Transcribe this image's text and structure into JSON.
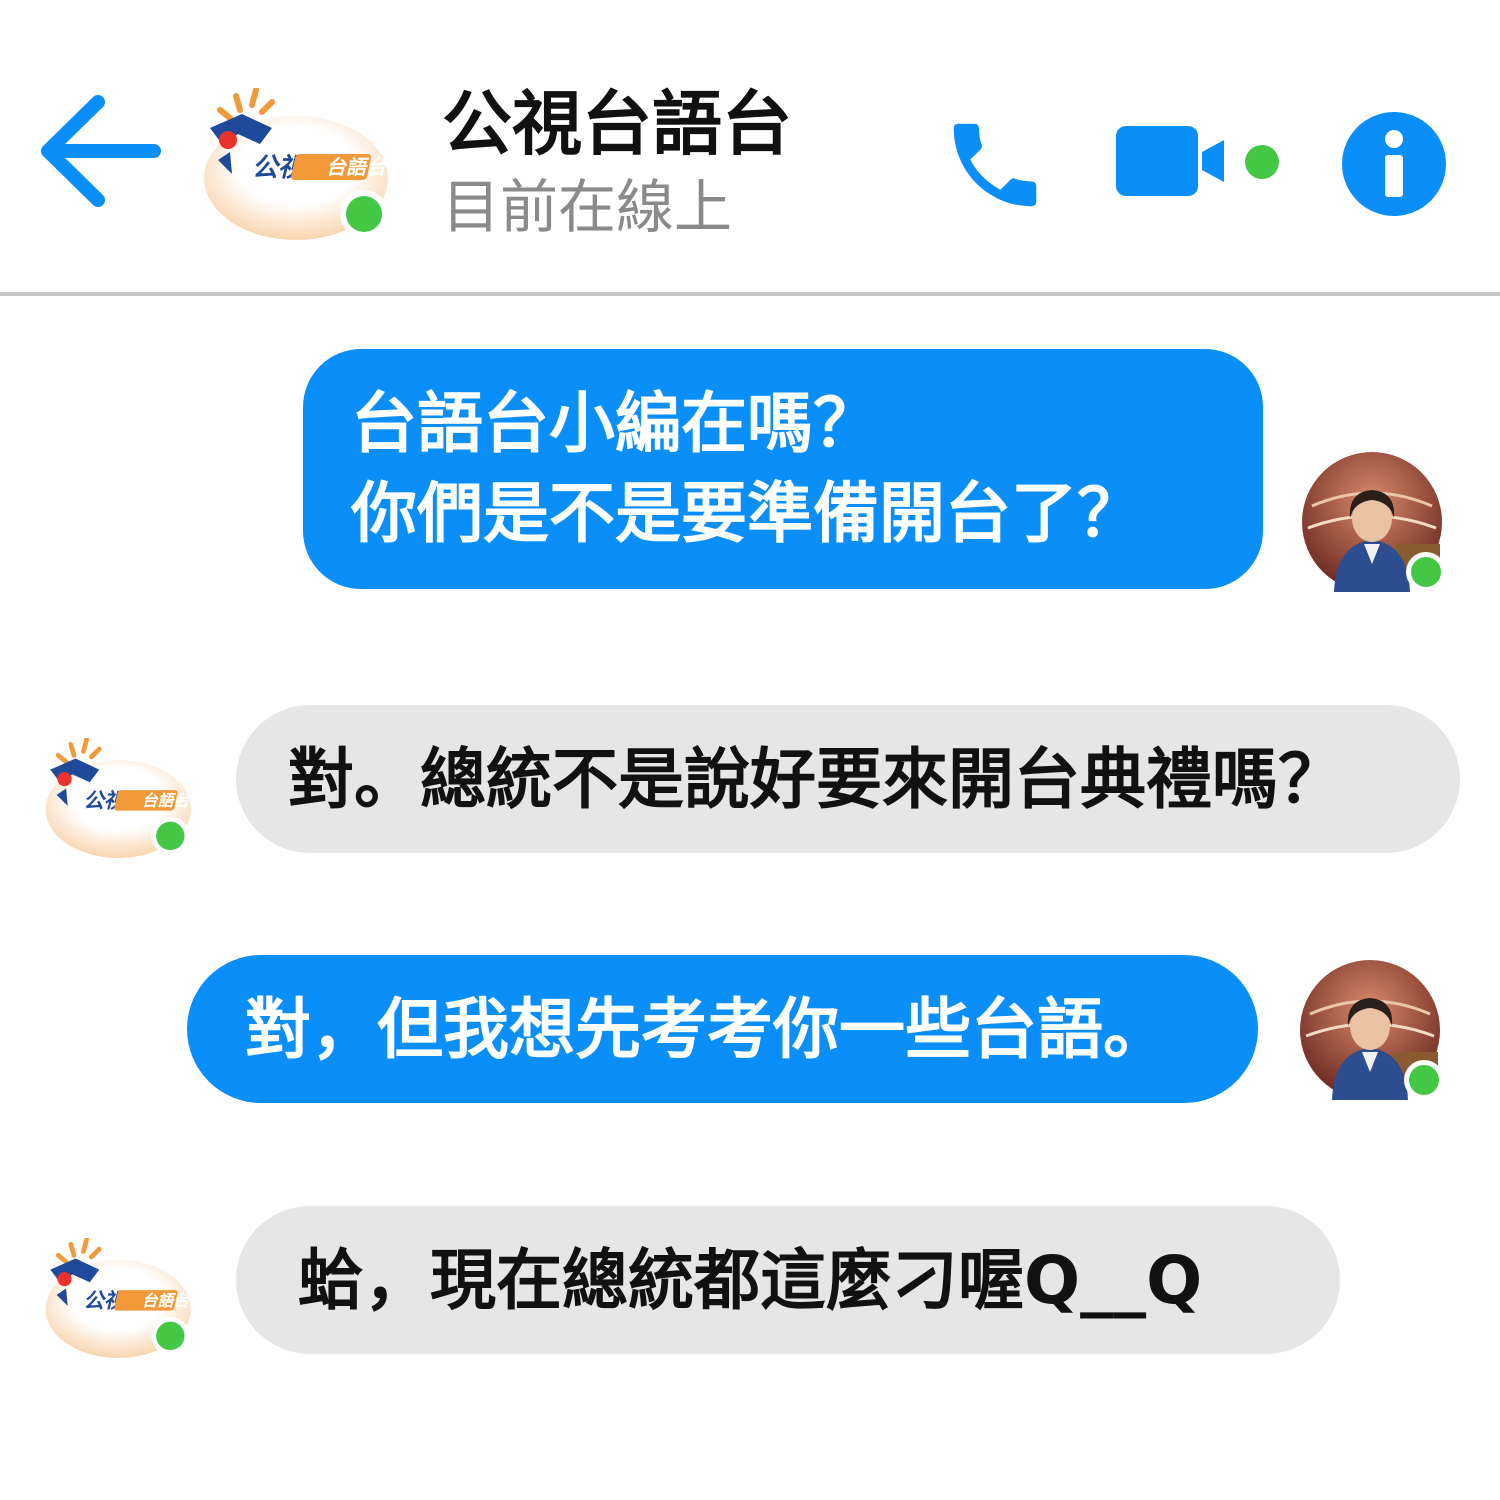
{
  "header": {
    "title": "公視台語台",
    "status": "目前在線上",
    "logo_text": "公視",
    "logo_badge": "台語台"
  },
  "messages": [
    {
      "sender": "user",
      "lines": [
        "台語台小編在嗎？",
        "你們是不是要準備開台了？"
      ]
    },
    {
      "sender": "channel",
      "lines": [
        "對。總統不是說好要來開台典禮嗎？"
      ]
    },
    {
      "sender": "user",
      "lines": [
        "對，但我想先考考你一些台語。"
      ]
    },
    {
      "sender": "channel",
      "lines": [
        "蛤，現在總統都這麼刁喔Q__Q"
      ]
    }
  ],
  "icons": {
    "back": "arrow-left-icon",
    "phone": "phone-icon",
    "video": "video-camera-icon",
    "info": "info-icon",
    "online": "online-status-dot"
  },
  "colors": {
    "accent": "#0a8ffa",
    "online": "#44c744",
    "incoming_bubble": "#e6e6e6",
    "outgoing_bubble": "#0a8ffa",
    "divider": "#c4c4c4",
    "logo_orange": "#f29a3a",
    "logo_navy": "#1f4a9c",
    "logo_red": "#e8322b"
  }
}
